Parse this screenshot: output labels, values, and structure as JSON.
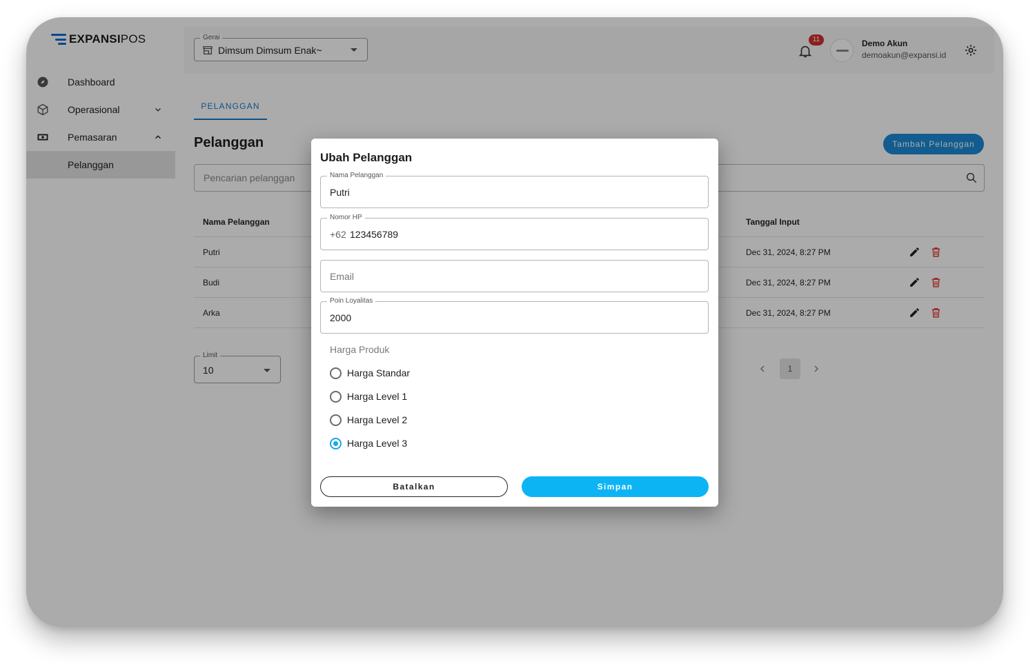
{
  "brand": {
    "logo_bold": "EXPANSI",
    "logo_light": "POS",
    "accent": "#0b6ad9"
  },
  "sidebar": {
    "items": [
      {
        "label": "Dashboard",
        "icon": "compass-icon"
      },
      {
        "label": "Operasional",
        "icon": "box-icon",
        "chevron": "chevron-down-icon"
      },
      {
        "label": "Pemasaran",
        "icon": "cash-icon",
        "chevron": "chevron-up-icon"
      },
      {
        "label": "Pelanggan",
        "active": true
      }
    ]
  },
  "topbar": {
    "outlet_label": "Gerai",
    "outlet_value": "Dimsum Dimsum Enak~",
    "notification_count": "11",
    "user_name": "Demo Akun",
    "user_email": "demoakun@expansi.id"
  },
  "page": {
    "tab": "PELANGGAN",
    "title": "Pelanggan",
    "add_button": "Tambah Pelanggan",
    "search_placeholder": "Pencarian pelanggan",
    "columns": {
      "name": "Nama Pelanggan",
      "date": "Tanggal Input"
    },
    "rows": [
      {
        "name": "Putri",
        "date": "Dec 31, 2024, 8:27 PM"
      },
      {
        "name": "Budi",
        "date": "Dec 31, 2024, 8:27 PM"
      },
      {
        "name": "Arka",
        "date": "Dec 31, 2024, 8:27 PM"
      }
    ],
    "limit_label": "Limit",
    "limit_value": "10",
    "current_page": "1"
  },
  "dialog": {
    "title": "Ubah Pelanggan",
    "name_label": "Nama Pelanggan",
    "name_value": "Putri",
    "phone_label": "Nomor HP",
    "phone_prefix": "+62",
    "phone_value": "123456789",
    "email_placeholder": "Email",
    "points_label": "Poin Loyalitas",
    "points_value": "2000",
    "price_group_label": "Harga Produk",
    "price_options": [
      "Harga Standar",
      "Harga Level 1",
      "Harga Level 2",
      "Harga Level 3"
    ],
    "selected_price_option": "Harga Level 3",
    "cancel_label": "Batalkan",
    "save_label": "Simpan",
    "save_color": "#0db4f4"
  }
}
